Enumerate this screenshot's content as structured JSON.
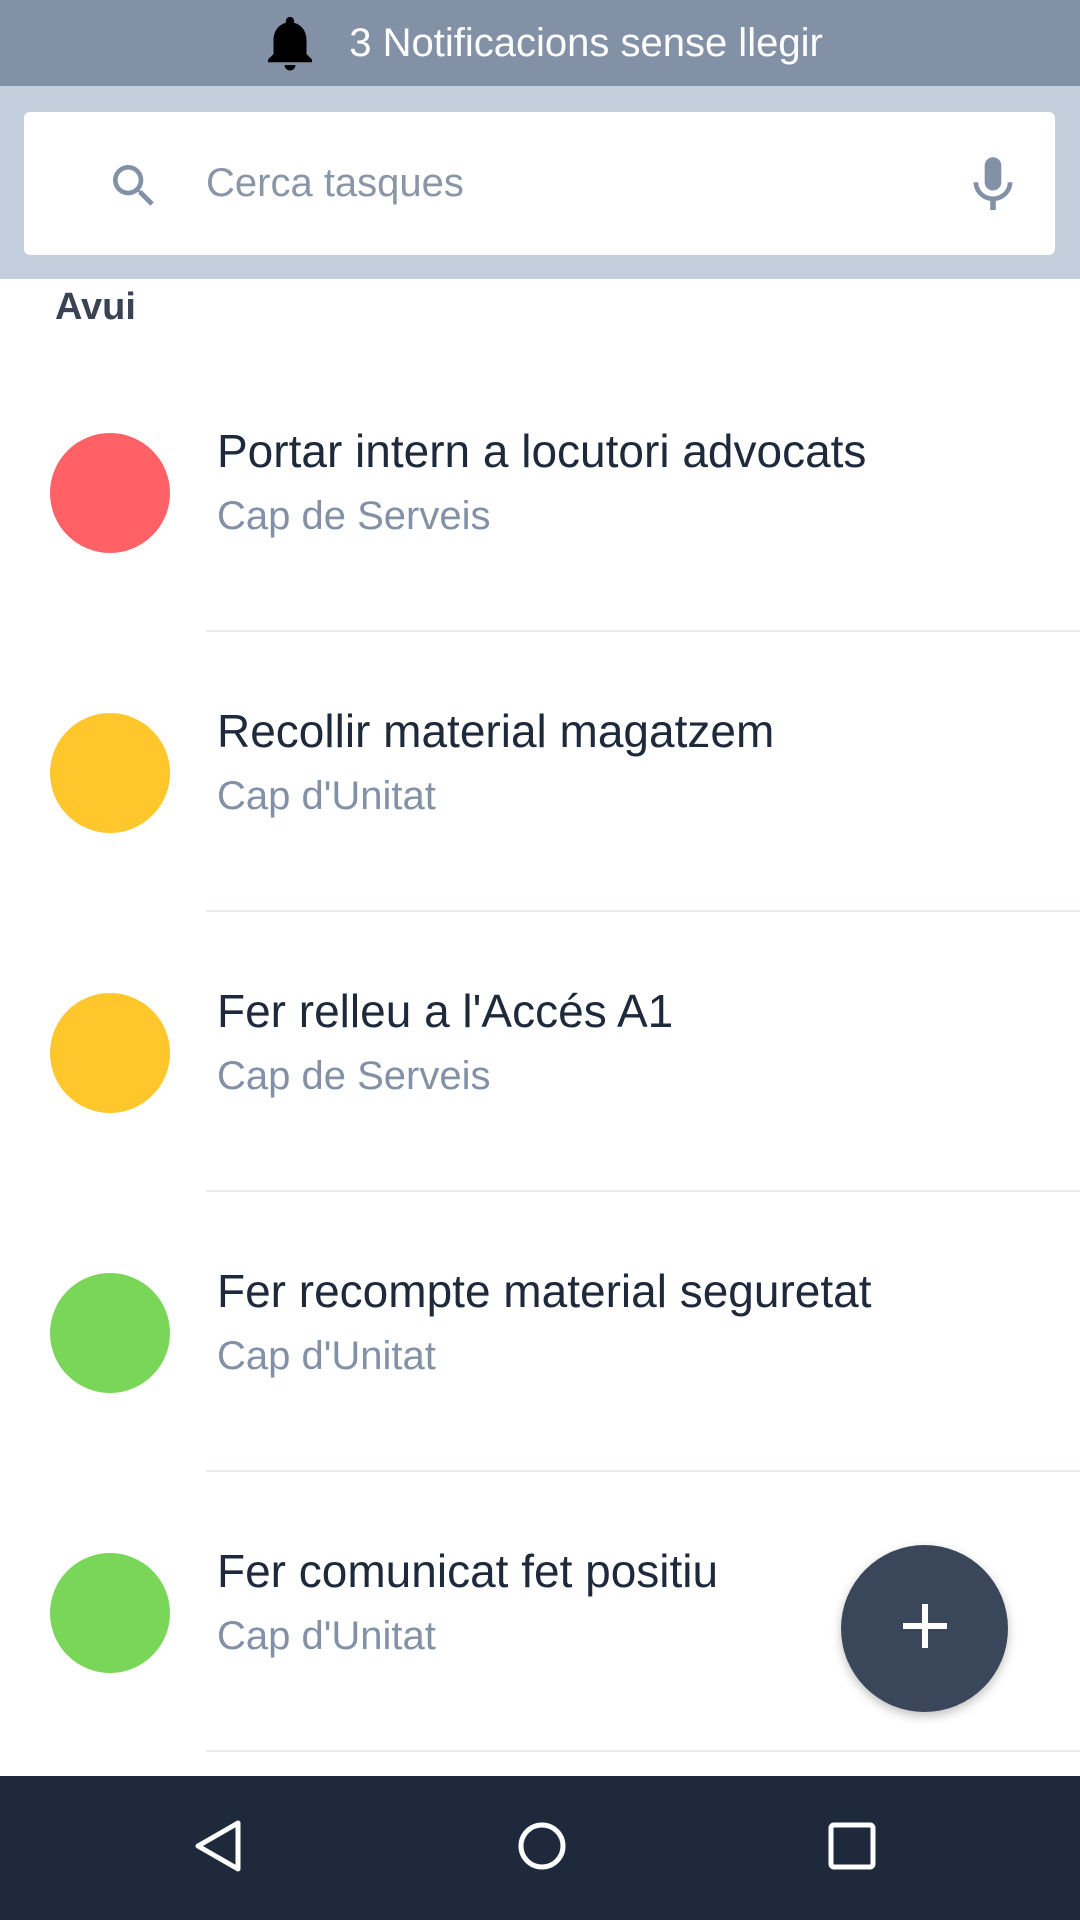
{
  "notification_bar": {
    "text": "3 Notificacions sense llegir",
    "icon": "bell-icon"
  },
  "search": {
    "placeholder": "Cerca tasques",
    "value": "",
    "search_icon": "search-icon",
    "mic_icon": "microphone-icon"
  },
  "section": {
    "title": "Avui"
  },
  "tasks": [
    {
      "title": "Portar intern a locutori advocats",
      "subtitle": "Cap de Serveis",
      "priority_color": "#ff6166"
    },
    {
      "title": "Recollir material magatzem",
      "subtitle": "Cap d'Unitat",
      "priority_color": "#ffc72c"
    },
    {
      "title": "Fer relleu a l'Accés A1",
      "subtitle": "Cap de Serveis",
      "priority_color": "#ffc72c"
    },
    {
      "title": "Fer recompte material seguretat",
      "subtitle": "Cap d'Unitat",
      "priority_color": "#79d659"
    },
    {
      "title": "Fer comunicat fet positiu",
      "subtitle": "Cap d'Unitat",
      "priority_color": "#79d659"
    }
  ],
  "fab": {
    "icon": "plus-icon"
  },
  "nav_bar": {
    "buttons": [
      "back-icon",
      "home-icon",
      "recents-icon"
    ]
  },
  "colors": {
    "notification_bg": "#8391a7",
    "search_area_bg": "#c3cfdd",
    "fab_bg": "#3a4659",
    "nav_bar_bg": "#1e2a3b"
  }
}
